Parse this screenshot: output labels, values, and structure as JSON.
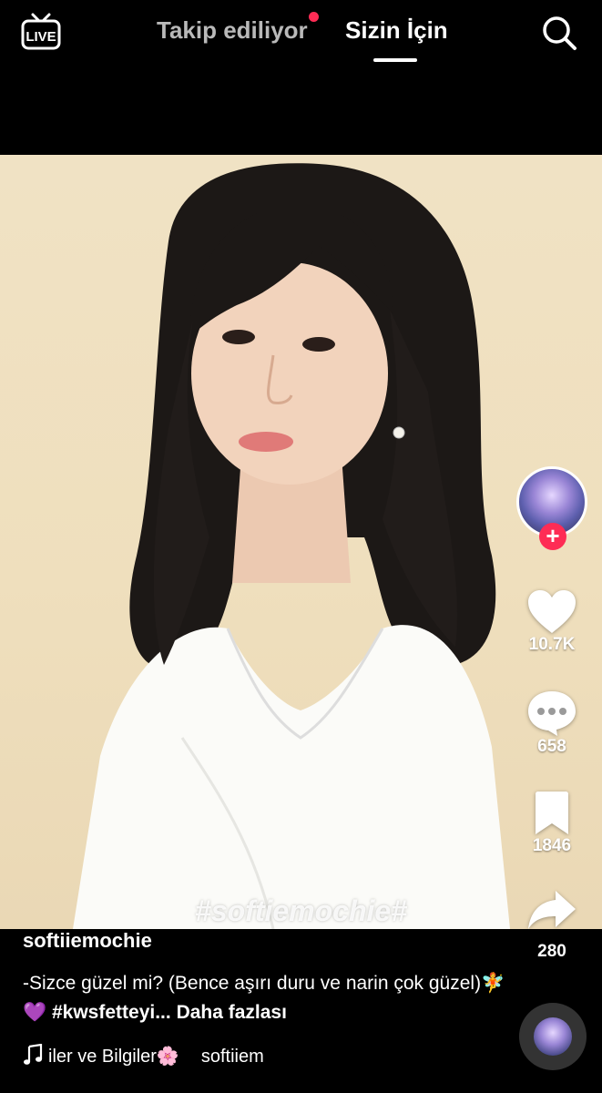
{
  "header": {
    "live_label": "LIVE",
    "tab_following": "Takip ediliyor",
    "tab_foryou": "Sizin İçin",
    "active_tab": "Sizin İçin"
  },
  "video": {
    "watermark": "#softiemochie#"
  },
  "actions": {
    "likes": "10.7K",
    "comments": "658",
    "bookmarks": "1846",
    "shares": "280"
  },
  "post": {
    "username": "softiiemochie",
    "caption_text": "-Sizce güzel mi? (Bence aşırı duru ve narin çok güzel)🧚💜 ",
    "hashtag": "#kwsfetteyi...",
    "more_label": "Daha fazlası",
    "music_title": "iler ve Bilgiler🌸",
    "music_artist": "softiiem"
  },
  "colors": {
    "accent": "#fe2c55",
    "background": "#000000",
    "video_bg": "#f0e2c4"
  },
  "icons": [
    "live-icon",
    "search-icon",
    "heart-icon",
    "comment-icon",
    "bookmark-icon",
    "share-icon",
    "music-note-icon",
    "plus-icon"
  ]
}
